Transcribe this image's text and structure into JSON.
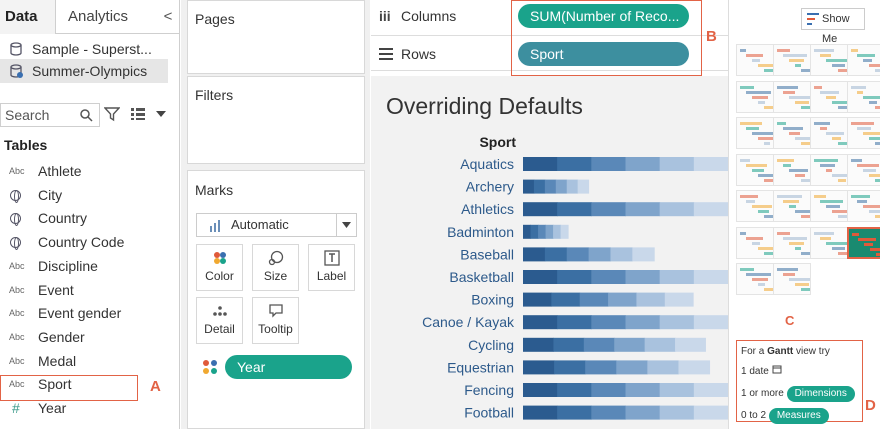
{
  "data_pane": {
    "tabs": [
      "Data",
      "Analytics"
    ],
    "collapse_glyph": "<",
    "datasources": [
      {
        "label": "Sample - Superst...",
        "icon": "database-icon",
        "selected": false
      },
      {
        "label": "Summer-Olympics",
        "icon": "database-icon",
        "selected": true
      }
    ],
    "search_placeholder": "Search",
    "tables_heading": "Tables",
    "fields": [
      {
        "label": "Athlete",
        "type": "Abc"
      },
      {
        "label": "City",
        "type": "globe"
      },
      {
        "label": "Country",
        "type": "globe"
      },
      {
        "label": "Country Code",
        "type": "globe"
      },
      {
        "label": "Discipline",
        "type": "Abc"
      },
      {
        "label": "Event",
        "type": "Abc"
      },
      {
        "label": "Event gender",
        "type": "Abc"
      },
      {
        "label": "Gender",
        "type": "Abc"
      },
      {
        "label": "Medal",
        "type": "Abc"
      },
      {
        "label": "Sport",
        "type": "Abc"
      },
      {
        "label": "Year",
        "type": "#"
      }
    ]
  },
  "cards": {
    "pages": "Pages",
    "filters": "Filters",
    "marks": "Marks",
    "mark_type": "Automatic",
    "mark_buttons": [
      "Color",
      "Size",
      "Label",
      "Detail",
      "Tooltip"
    ],
    "color_pill": "Year"
  },
  "shelves": {
    "columns_label": "Columns",
    "columns_icon": "iii",
    "columns_pill": "SUM(Number of Reco...",
    "rows_label": "Rows",
    "rows_pill": "Sport"
  },
  "view": {
    "title": "Overriding Defaults",
    "row_header": "Sport"
  },
  "chart_data": {
    "type": "bar",
    "title": "Overriding Defaults",
    "ylabel": "Sport",
    "stacked_by": "Year",
    "categories": [
      "Aquatics",
      "Archery",
      "Athletics",
      "Badminton",
      "Baseball",
      "Basketball",
      "Boxing",
      "Canoe / Kayak",
      "Cycling",
      "Equestrian",
      "Fencing",
      "Football"
    ],
    "values": [
      1.0,
      0.32,
      1.0,
      0.22,
      0.64,
      1.0,
      0.83,
      1.0,
      0.89,
      0.91,
      1.0,
      1.0
    ],
    "value_note": "relative bar lengths; bars at 1.0 are truncated by the view edge",
    "colors": [
      "#2b5b8f",
      "#3b6fa3",
      "#5a88b8",
      "#7fa4cb",
      "#a9c2de",
      "#c9d8ea"
    ]
  },
  "show_me": {
    "title": "Show Me",
    "hint_intro_pre": "For a ",
    "hint_intro_bold": "Gantt",
    "hint_intro_post": " view try",
    "hint_lines": [
      {
        "prefix": "1 date",
        "pill": ""
      },
      {
        "prefix": "1 or more",
        "pill": "Dimensions"
      },
      {
        "prefix": "0 to 2",
        "pill": "Measures"
      }
    ]
  },
  "annotations": {
    "labels": [
      "A",
      "B",
      "C",
      "D"
    ],
    "color": "#e26346"
  }
}
